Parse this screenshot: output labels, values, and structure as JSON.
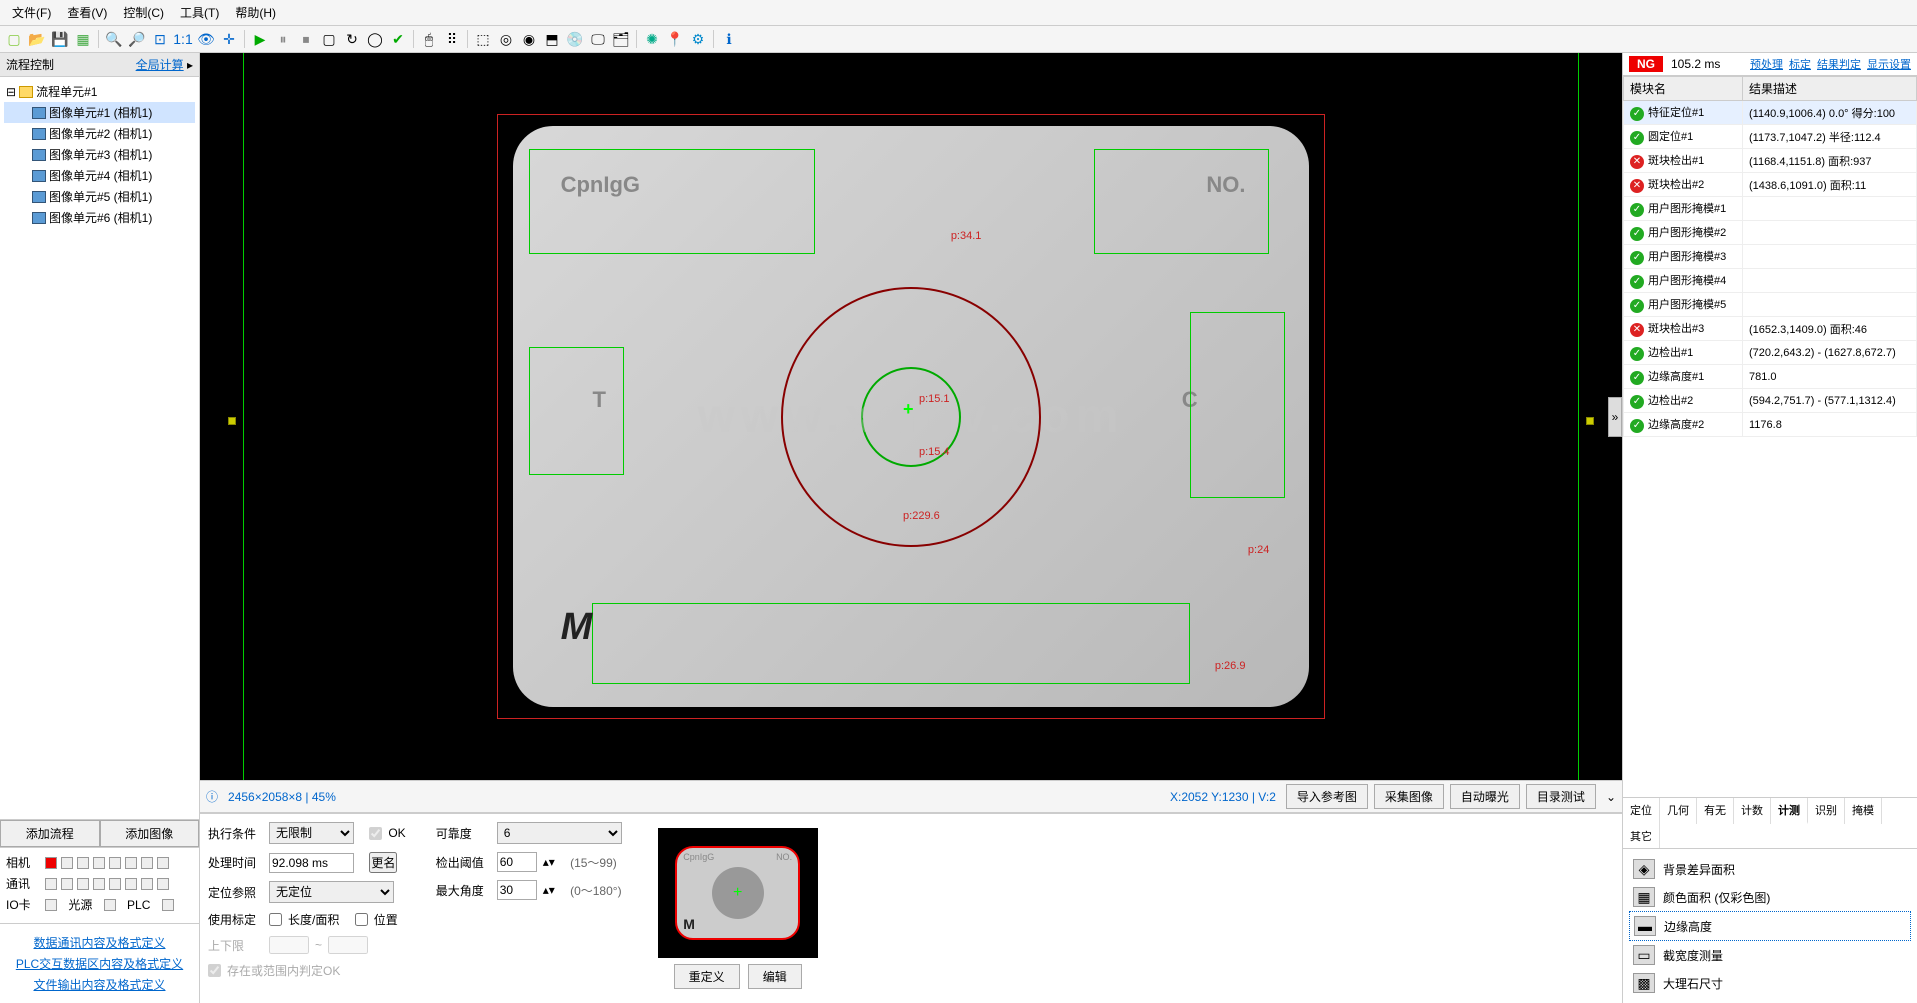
{
  "menu": {
    "file": "文件(F)",
    "view": "查看(V)",
    "control": "控制(C)",
    "tools": "工具(T)",
    "help": "帮助(H)"
  },
  "left": {
    "title": "流程控制",
    "globalCalc": "全局计算",
    "rootName": "流程单元#1",
    "items": [
      {
        "label": "图像单元#1 (相机1)",
        "sel": true
      },
      {
        "label": "图像单元#2 (相机1)"
      },
      {
        "label": "图像单元#3 (相机1)"
      },
      {
        "label": "图像单元#4 (相机1)"
      },
      {
        "label": "图像单元#5 (相机1)"
      },
      {
        "label": "图像单元#6 (相机1)"
      }
    ],
    "addFlow": "添加流程",
    "addImage": "添加图像",
    "camera": "相机",
    "comm": "通讯",
    "io": "IO卡",
    "light": "光源",
    "plc": "PLC",
    "links": [
      "数据通讯内容及格式定义",
      "PLC交互数据区内容及格式定义",
      "文件输出内容及格式定义"
    ]
  },
  "viewer": {
    "textCpn": "CpnIgG",
    "textNo": "NO.",
    "textT": "T",
    "textC": "C",
    "p1": "p:34.1",
    "p2": "p:15.1",
    "p3": "p:15.4",
    "p4": "p:229.6",
    "p5": "p:24",
    "p6": "p:26.9",
    "watermark": "www.xamv.com",
    "sig": "M"
  },
  "status": {
    "info": "2456×2058×8 | 45%",
    "coords": "X:2052 Y:1230 | V:2",
    "btns": [
      "导入参考图",
      "采集图像",
      "自动曝光",
      "目录测试"
    ]
  },
  "params": {
    "execCond": "执行条件",
    "execVal": "无限制",
    "ok": "OK",
    "procTime": "处理时间",
    "procVal": "92.098 ms",
    "rename": "更名",
    "posRef": "定位参照",
    "posVal": "无定位",
    "useCalib": "使用标定",
    "lenArea": "长度/面积",
    "position": "位置",
    "range": "上下限",
    "rangeSep": "~",
    "inRange": "存在或范围内判定OK",
    "reliability": "可靠度",
    "reliVal": "6",
    "threshold": "检出阈值",
    "thVal": "60",
    "thHint": "(15～99)",
    "maxAngle": "最大角度",
    "maxVal": "30",
    "maxHint": "(0～180°)",
    "redefine": "重定义",
    "edit": "编辑"
  },
  "right": {
    "ng": "NG",
    "time": "105.2 ms",
    "links": [
      "预处理",
      "标定",
      "结果判定",
      "显示设置"
    ],
    "col1": "模块名",
    "col2": "结果描述",
    "rows": [
      {
        "st": "ok",
        "name": "特征定位#1",
        "desc": "(1140.9,1006.4) 0.0° 得分:100",
        "sel": true
      },
      {
        "st": "ok",
        "name": "圆定位#1",
        "desc": "(1173.7,1047.2) 半径:112.4"
      },
      {
        "st": "ng",
        "name": "斑块检出#1",
        "desc": "(1168.4,1151.8) 面积:937"
      },
      {
        "st": "ng",
        "name": "斑块检出#2",
        "desc": "(1438.6,1091.0) 面积:11"
      },
      {
        "st": "ok",
        "name": "用户图形掩模#1",
        "desc": ""
      },
      {
        "st": "ok",
        "name": "用户图形掩模#2",
        "desc": ""
      },
      {
        "st": "ok",
        "name": "用户图形掩模#3",
        "desc": ""
      },
      {
        "st": "ok",
        "name": "用户图形掩模#4",
        "desc": ""
      },
      {
        "st": "ok",
        "name": "用户图形掩模#5",
        "desc": ""
      },
      {
        "st": "ng",
        "name": "斑块检出#3",
        "desc": "(1652.3,1409.0) 面积:46"
      },
      {
        "st": "ok",
        "name": "边检出#1",
        "desc": "(720.2,643.2) - (1627.8,672.7)"
      },
      {
        "st": "ok",
        "name": "边缘高度#1",
        "desc": "781.0"
      },
      {
        "st": "ok",
        "name": "边检出#2",
        "desc": "(594.2,751.7) - (577.1,1312.4)"
      },
      {
        "st": "ok",
        "name": "边缘高度#2",
        "desc": "1176.8"
      }
    ],
    "tabs": [
      "定位",
      "几何",
      "有无",
      "计数",
      "计测",
      "识别",
      "掩模",
      "其它"
    ],
    "activeTab": 4,
    "tools": [
      {
        "icon": "◈",
        "label": "背景差异面积"
      },
      {
        "icon": "▦",
        "label": "颜色面积 (仅彩色图)"
      },
      {
        "icon": "▬",
        "label": "边缘高度",
        "sel": true
      },
      {
        "icon": "▭",
        "label": "截宽度测量"
      },
      {
        "icon": "▩",
        "label": "大理石尺寸"
      }
    ]
  }
}
